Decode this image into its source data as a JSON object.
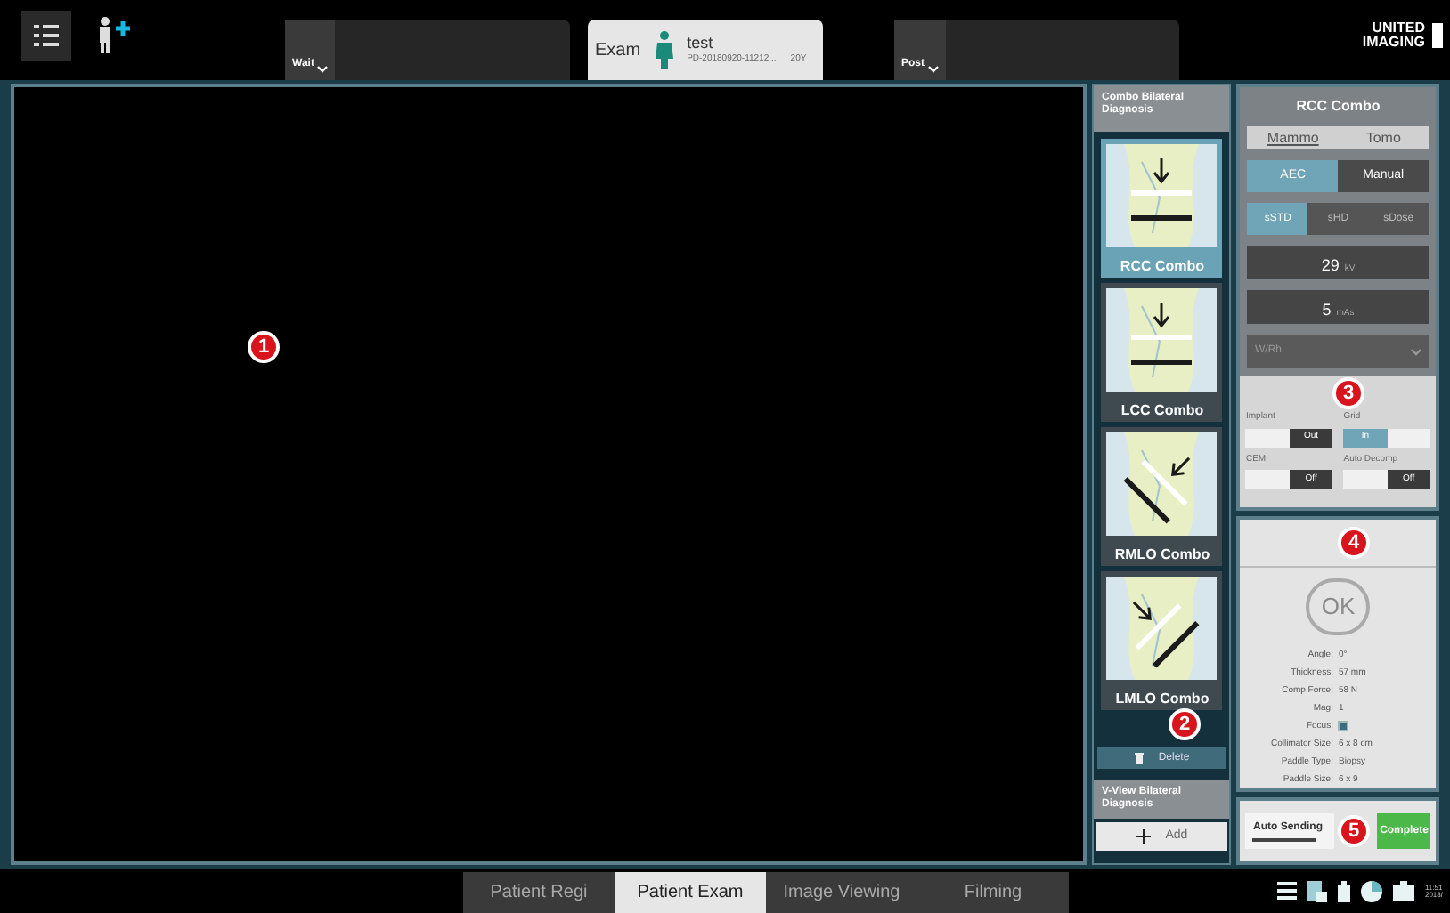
{
  "top_bar": {
    "workflow_tabs": [
      {
        "label": "Wait",
        "kind": "dropdown",
        "selected": false
      },
      {
        "label": "Exam",
        "kind": "patient",
        "selected": true,
        "patient_name": "test",
        "patient_id": "PD-20180920-11212...",
        "age": "20Y"
      },
      {
        "label": "Post",
        "kind": "dropdown",
        "selected": false
      }
    ],
    "logo": "UNITED IMAGING"
  },
  "callouts": [
    "1",
    "2",
    "3",
    "4",
    "5"
  ],
  "protocol_list": {
    "group": "Combo Bilateral Diagnosis",
    "views": [
      {
        "label": "RCC Combo",
        "selected": true,
        "kind": "cc"
      },
      {
        "label": "LCC Combo",
        "selected": false,
        "kind": "cc"
      },
      {
        "label": "RMLO Combo",
        "selected": false,
        "kind": "rmlo"
      },
      {
        "label": "LMLO Combo",
        "selected": false,
        "kind": "lmlo"
      }
    ],
    "delete_button": "Delete",
    "next_group": "V-View Bilateral Diagnosis",
    "add_button": "Add"
  },
  "exposure_panel": {
    "title": "RCC Combo",
    "mode_tabs": [
      {
        "label": "Mammo",
        "selected": true
      },
      {
        "label": "Tomo",
        "selected": false
      }
    ],
    "exposure_modes": [
      {
        "label": "AEC",
        "selected": true
      },
      {
        "label": "Manual",
        "selected": false
      }
    ],
    "dose_modes": [
      {
        "label": "sSTD",
        "selected": true
      },
      {
        "label": "sHD",
        "selected": false
      },
      {
        "label": "sDose",
        "selected": false
      }
    ],
    "kv": {
      "value": "29",
      "unit": "kV"
    },
    "mas": {
      "value": "5",
      "unit": "mAs"
    },
    "filter": "W/Rh",
    "toggles": [
      {
        "label": "Implant",
        "value": "Out",
        "on": false
      },
      {
        "label": "Grid",
        "value": "In",
        "on": true
      },
      {
        "label": "CEM",
        "value": "Off",
        "on": false
      },
      {
        "label": "Auto Decomp",
        "value": "Off",
        "on": false
      }
    ]
  },
  "status_panel": {
    "status": "OK",
    "fields": [
      {
        "label": "Angle:",
        "value": "0°"
      },
      {
        "label": "Thickness:",
        "value": "57 mm"
      },
      {
        "label": "Comp Force:",
        "value": "58 N"
      },
      {
        "label": "Mag:",
        "value": "1"
      },
      {
        "label": "Focus:",
        "kind": "icon"
      },
      {
        "label": "Collimator Size:",
        "value": "6 x 8 cm"
      },
      {
        "label": "Paddle Type:",
        "value": "Biopsy"
      },
      {
        "label": "Paddle Size:",
        "value": "6 x 9"
      }
    ]
  },
  "action_panel": {
    "auto_sending": {
      "label": "Auto Sending",
      "on": false
    },
    "complete_button": "Complete"
  },
  "bottom_tabs": [
    {
      "label": "Patient Regi",
      "selected": false
    },
    {
      "label": "Patient Exam",
      "selected": true
    },
    {
      "label": "Image Viewing",
      "selected": false
    },
    {
      "label": "Filming",
      "selected": false
    }
  ],
  "clock": {
    "time": "11:51",
    "date": "2018/"
  }
}
